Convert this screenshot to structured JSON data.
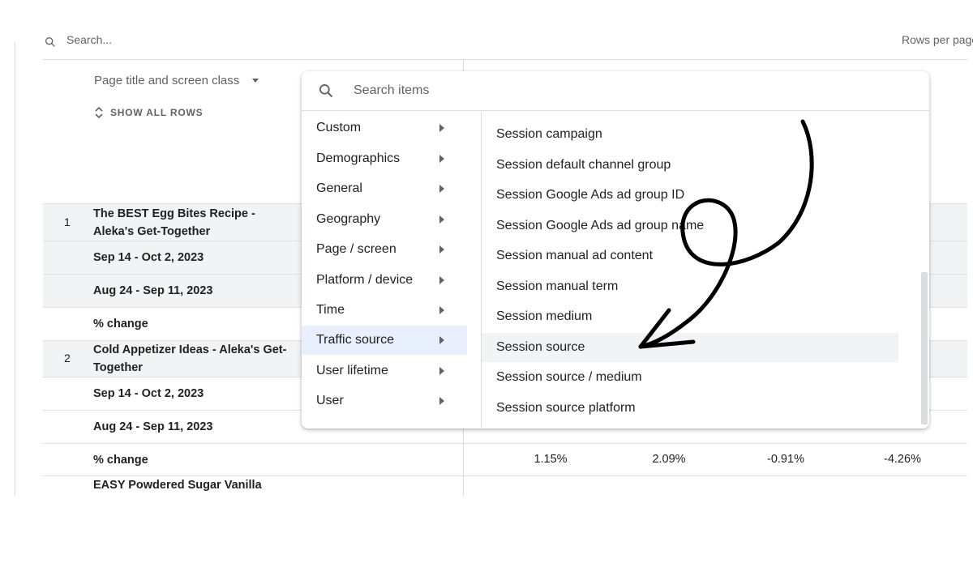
{
  "top": {
    "search_placeholder": "Search...",
    "rows_per_page_label": "Rows per page"
  },
  "table": {
    "dimension_header": "Page title and screen class",
    "show_all_rows": "SHOW ALL ROWS",
    "rows": [
      {
        "num": "1",
        "label": "The BEST Egg Bites Recipe - Aleka's Get-Together",
        "type": "title"
      },
      {
        "label": "Sep 14 - Oct 2, 2023",
        "type": "period"
      },
      {
        "label": "Aug 24 - Sep 11, 2023",
        "type": "period"
      },
      {
        "label": "% change",
        "type": "change"
      },
      {
        "num": "2",
        "label": "Cold Appetizer Ideas - Aleka's Get-Together",
        "type": "title"
      },
      {
        "label": "Sep 14 - Oct 2, 2023",
        "type": "period"
      },
      {
        "label": "Aug 24 - Sep 11, 2023",
        "type": "period"
      },
      {
        "label": "% change",
        "type": "change",
        "values": [
          "1.15%",
          "2.09%",
          "-0.91%",
          "-4.26%"
        ]
      },
      {
        "label": "EASY Powdered Sugar Vanilla",
        "type": "title"
      }
    ]
  },
  "dropdown": {
    "search_placeholder": "Search items",
    "categories": [
      {
        "label": "Custom"
      },
      {
        "label": "Demographics"
      },
      {
        "label": "General"
      },
      {
        "label": "Geography"
      },
      {
        "label": "Page / screen"
      },
      {
        "label": "Platform / device"
      },
      {
        "label": "Time"
      },
      {
        "label": "Traffic source",
        "active": true
      },
      {
        "label": "User lifetime"
      },
      {
        "label": "User"
      }
    ],
    "options": [
      {
        "label": "Session campaign"
      },
      {
        "label": "Session default channel group"
      },
      {
        "label": "Session Google Ads ad group ID"
      },
      {
        "label": "Session Google Ads ad group name"
      },
      {
        "label": "Session manual ad content"
      },
      {
        "label": "Session manual term"
      },
      {
        "label": "Session medium"
      },
      {
        "label": "Session source",
        "highlighted": true
      },
      {
        "label": "Session source / medium"
      },
      {
        "label": "Session source platform"
      }
    ]
  },
  "colors": {
    "active_category_bg": "#e8f0fe",
    "hover_option_bg": "#f1f3f4",
    "annotation_stroke": "#000000"
  }
}
